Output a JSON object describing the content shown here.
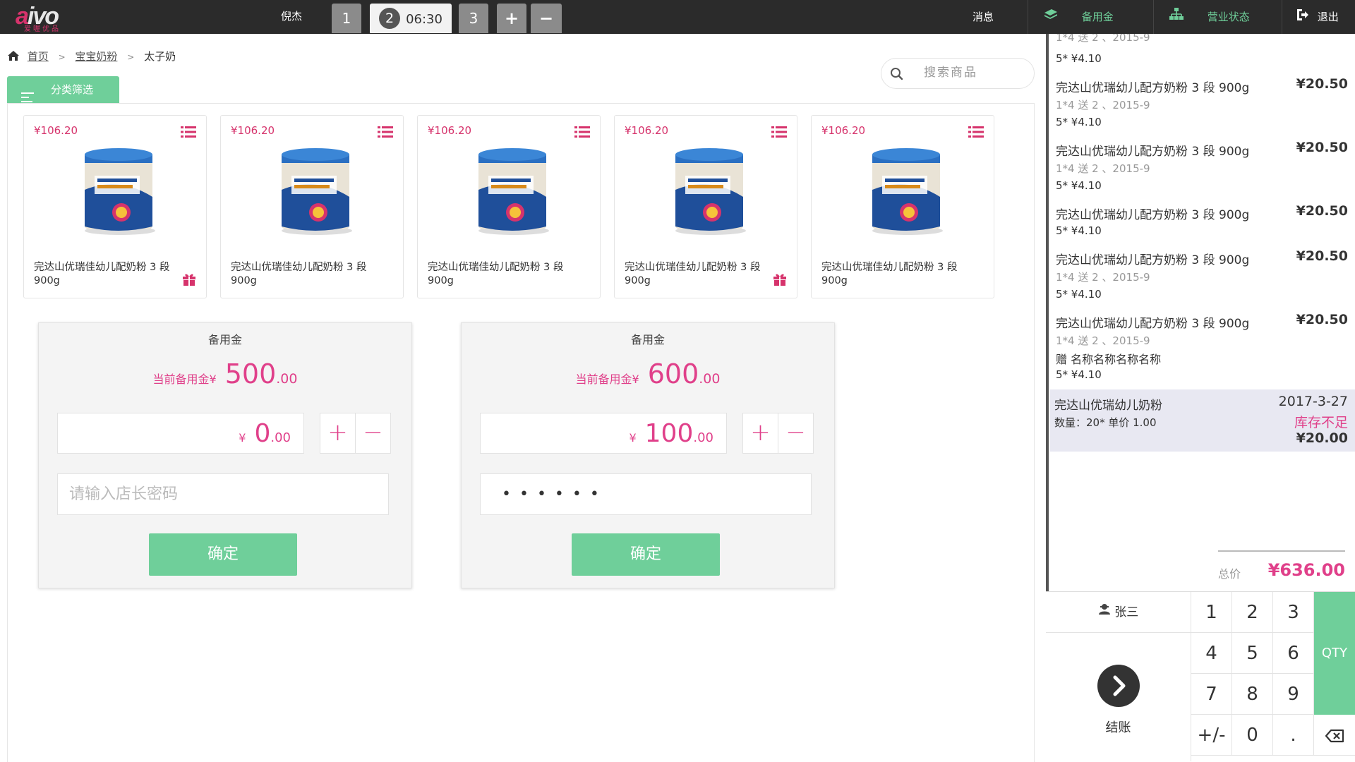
{
  "topbar": {
    "logo_text": "aivo",
    "logo_sub": "爱喔优品",
    "user": "倪杰",
    "tabs": [
      {
        "label": "1"
      },
      {
        "label": "2",
        "time": "06:30"
      },
      {
        "label": "3"
      }
    ],
    "add_tab": "+",
    "remove_tab": "−",
    "messages": "消息",
    "petty_cash": "备用金",
    "business_status": "营业状态",
    "logout": "退出"
  },
  "breadcrumb": {
    "home": "首页",
    "category": "宝宝奶粉",
    "current": "太子奶",
    "sep": ">"
  },
  "search": {
    "placeholder": "搜索商品"
  },
  "filter": {
    "label": "分类筛选"
  },
  "products": [
    {
      "price": "¥106.20",
      "name": "完达山优瑞佳幼儿配奶粉 3 段 900g",
      "gift": true
    },
    {
      "price": "¥106.20",
      "name": "完达山优瑞佳幼儿配奶粉 3 段 900g",
      "gift": false
    },
    {
      "price": "¥106.20",
      "name": "完达山优瑞佳幼儿配奶粉 3 段 900g",
      "gift": false
    },
    {
      "price": "¥106.20",
      "name": "完达山优瑞佳幼儿配奶粉 3 段 900g",
      "gift": true
    },
    {
      "price": "¥106.20",
      "name": "完达山优瑞佳幼儿配奶粉 3 段 900g",
      "gift": false
    }
  ],
  "funds": [
    {
      "title": "备用金",
      "current_label": "当前备用金¥",
      "current_int": "500",
      "current_dec": ".00",
      "amount_yen": "¥",
      "amount_int": "0",
      "amount_dec": ".00",
      "password_placeholder": "请输入店长密码",
      "password_value": "",
      "confirm": "确定"
    },
    {
      "title": "备用金",
      "current_label": "当前备用金¥",
      "current_int": "600",
      "current_dec": ".00",
      "amount_yen": "¥",
      "amount_int": "100",
      "amount_dec": ".00",
      "password_placeholder": "",
      "password_value": "••••••",
      "confirm": "确定"
    }
  ],
  "fund_plus": "+",
  "fund_minus": "−",
  "orders": [
    {
      "name": "",
      "price": "",
      "meta": "1*4 送 2 、2015-9",
      "qty": "5* ¥4.10"
    },
    {
      "name": "完达山优瑞幼儿配方奶粉 3 段 900g",
      "price": "¥20.50",
      "meta": "1*4 送 2 、2015-9",
      "qty": "5* ¥4.10"
    },
    {
      "name": "完达山优瑞幼儿配方奶粉 3 段 900g",
      "price": "¥20.50",
      "meta": "1*4 送 2 、2015-9",
      "qty": "5* ¥4.10"
    },
    {
      "name": "完达山优瑞幼儿配方奶粉 3 段 900g",
      "price": "¥20.50",
      "meta": "",
      "qty": "5* ¥4.10"
    },
    {
      "name": "完达山优瑞幼儿配方奶粉 3 段 900g",
      "price": "¥20.50",
      "meta": "1*4 送 2 、2015-9",
      "qty": "5* ¥4.10"
    },
    {
      "name": "完达山优瑞幼儿配方奶粉 3 段 900g",
      "price": "¥20.50",
      "meta": "1*4 送 2 、2015-9",
      "gift": "赠 名称名称名称名称",
      "qty": "5* ¥4.10"
    }
  ],
  "highlight_order": {
    "name": "完达山优瑞幼儿奶粉",
    "date": "2017-3-27",
    "detail": "数量：20* 单价 1.00",
    "warning": "库存不足",
    "price": "¥20.00"
  },
  "total": {
    "label": "总价",
    "value": "¥636.00"
  },
  "keypad": {
    "customer": "张三",
    "checkout": "结账",
    "keys": [
      "1",
      "2",
      "3",
      "4",
      "5",
      "6",
      "7",
      "8",
      "9",
      "+/-",
      "0",
      "."
    ],
    "qty": "QTY"
  },
  "colors": {
    "accent_green": "#6fcf9a",
    "accent_pink": "#e0408a",
    "topbar": "#2b2b2b"
  }
}
